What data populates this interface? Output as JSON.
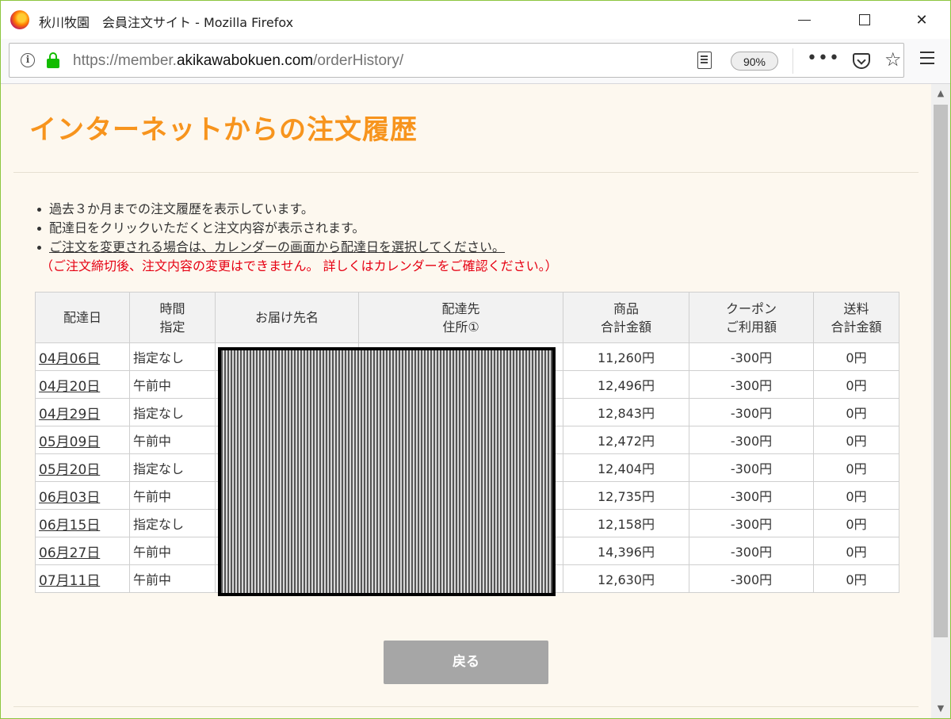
{
  "window": {
    "title": "秋川牧園　会員注文サイト - Mozilla Firefox"
  },
  "navbar": {
    "url_prefix": "https://member.",
    "url_domain": "akikawabokuen.com",
    "url_path": "/orderHistory/",
    "zoom": "90%"
  },
  "page": {
    "title": "インターネットからの注文履歴",
    "notes": [
      "過去３か月までの注文履歴を表示しています。",
      "配達日をクリックいただくと注文内容が表示されます。",
      "ご注文を変更される場合は、カレンダーの画面から配達日を選択してください。"
    ],
    "warning": "（ご注文締切後、注文内容の変更はできません。 詳しくはカレンダーをご確認ください。）",
    "back_button": "戻る"
  },
  "table": {
    "headers": [
      "配達日",
      "時間\n指定",
      "お届け先名",
      "配達先\n住所①",
      "商品\n合計金額",
      "クーポン\nご利用額",
      "送料\n合計金額"
    ],
    "rows": [
      {
        "date": "04月06日",
        "time": "指定なし",
        "goods": "11,260円",
        "coupon": "-300円",
        "shipping": "0円"
      },
      {
        "date": "04月20日",
        "time": "午前中",
        "goods": "12,496円",
        "coupon": "-300円",
        "shipping": "0円"
      },
      {
        "date": "04月29日",
        "time": "指定なし",
        "goods": "12,843円",
        "coupon": "-300円",
        "shipping": "0円"
      },
      {
        "date": "05月09日",
        "time": "午前中",
        "goods": "12,472円",
        "coupon": "-300円",
        "shipping": "0円"
      },
      {
        "date": "05月20日",
        "time": "指定なし",
        "goods": "12,404円",
        "coupon": "-300円",
        "shipping": "0円"
      },
      {
        "date": "06月03日",
        "time": "午前中",
        "goods": "12,735円",
        "coupon": "-300円",
        "shipping": "0円"
      },
      {
        "date": "06月15日",
        "time": "指定なし",
        "goods": "12,158円",
        "coupon": "-300円",
        "shipping": "0円"
      },
      {
        "date": "06月27日",
        "time": "午前中",
        "goods": "14,396円",
        "coupon": "-300円",
        "shipping": "0円"
      },
      {
        "date": "07月11日",
        "time": "午前中",
        "goods": "12,630円",
        "coupon": "-300円",
        "shipping": "0円"
      }
    ]
  },
  "colors": {
    "title_orange": "#f7941d",
    "warning_red": "#e60012",
    "page_background": "#fdf8ef",
    "button_gray": "#a6a6a6",
    "lock_green": "#12bc00"
  },
  "icons": [
    "firefox-logo-icon",
    "info-icon",
    "lock-icon",
    "reader-view-icon",
    "more-actions-icon",
    "pocket-icon",
    "bookmark-star-icon",
    "hamburger-menu-icon"
  ]
}
